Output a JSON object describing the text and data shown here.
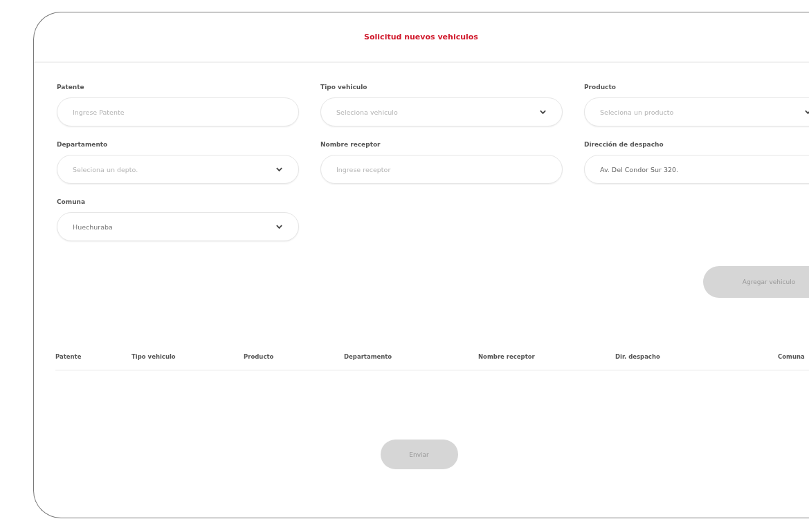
{
  "title": "Solicitud nuevos vehiculos",
  "fields": [
    {
      "label": "Patente",
      "kind": "text",
      "placeholder": "Ingrese Patente"
    },
    {
      "label": "Tipo vehiculo",
      "kind": "select",
      "placeholder": "Seleciona vehiculo"
    },
    {
      "label": "Producto",
      "kind": "select",
      "placeholder": "Seleciona un producto"
    },
    {
      "label": "Departamento",
      "kind": "select",
      "placeholder": "Seleciona un depto."
    },
    {
      "label": "Nombre receptor",
      "kind": "text",
      "placeholder": "Ingrese receptor"
    },
    {
      "label": "Dirección de despacho",
      "kind": "text",
      "value": "Av. Del Condor Sur 320."
    },
    {
      "label": "Comuna",
      "kind": "select",
      "value": "Huechuraba"
    }
  ],
  "add_button": {
    "label": "Agregar vehiculo",
    "disabled": true
  },
  "table": {
    "columns": [
      "Patente",
      "Tipo vehiculo",
      "Producto",
      "Departamento",
      "Nombre receptor",
      "Dir. despacho",
      "Comuna"
    ]
  },
  "submit_button": {
    "label": "Enviar",
    "disabled": true
  }
}
